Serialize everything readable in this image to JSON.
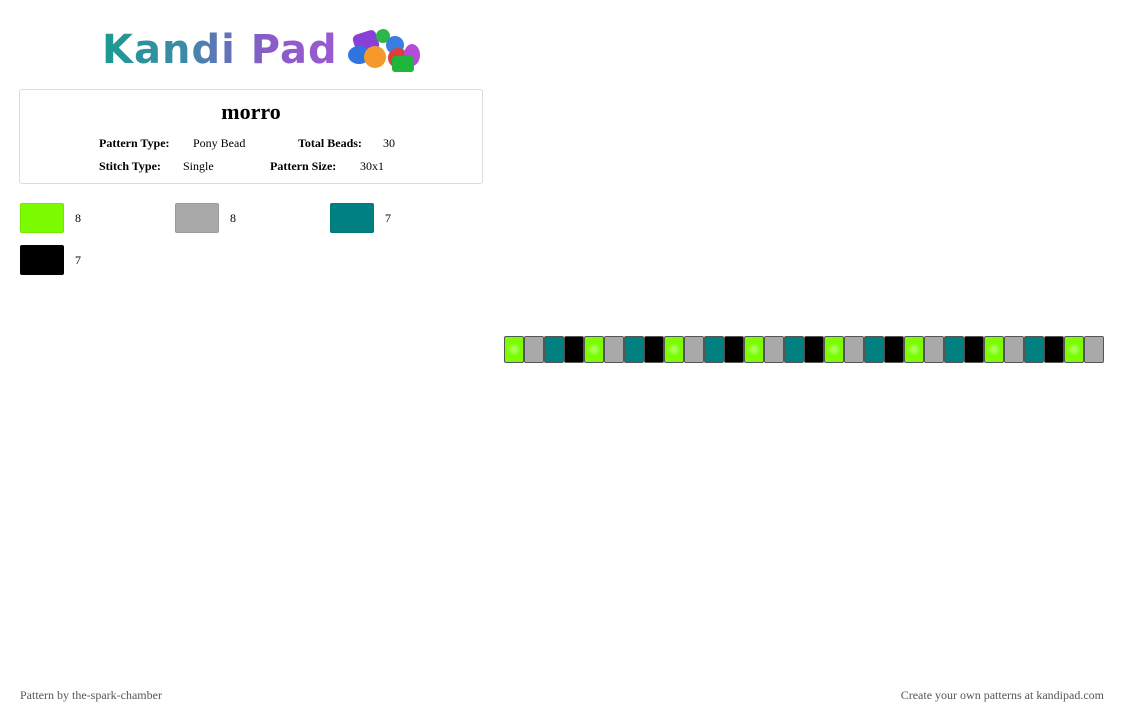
{
  "logo": {
    "text": "Kandi Pad"
  },
  "pattern": {
    "title": "morro",
    "type_label": "Pattern Type:",
    "type_value": "Pony Bead",
    "total_label": "Total Beads:",
    "total_value": "30",
    "stitch_label": "Stitch Type:",
    "stitch_value": "Single",
    "size_label": "Pattern Size:",
    "size_value": "30x1"
  },
  "colors": [
    {
      "hex": "#7cfc00",
      "count": "8"
    },
    {
      "hex": "#a9a9a9",
      "count": "8"
    },
    {
      "hex": "#008080",
      "count": "7"
    },
    {
      "hex": "#000000",
      "count": "7"
    }
  ],
  "beads": [
    "#7cfc00",
    "#a9a9a9",
    "#008080",
    "#000000",
    "#7cfc00",
    "#a9a9a9",
    "#008080",
    "#000000",
    "#7cfc00",
    "#a9a9a9",
    "#008080",
    "#000000",
    "#7cfc00",
    "#a9a9a9",
    "#008080",
    "#000000",
    "#7cfc00",
    "#a9a9a9",
    "#008080",
    "#000000",
    "#7cfc00",
    "#a9a9a9",
    "#008080",
    "#000000",
    "#7cfc00",
    "#a9a9a9",
    "#008080",
    "#000000",
    "#7cfc00",
    "#a9a9a9"
  ],
  "footer": {
    "credit": "Pattern by the-spark-chamber",
    "cta": "Create your own patterns at kandipad.com"
  }
}
